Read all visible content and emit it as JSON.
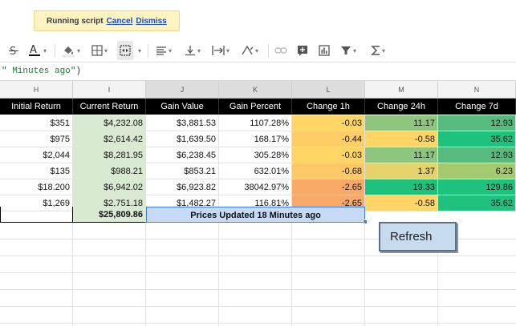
{
  "toast": {
    "label": "Running script",
    "cancel": "Cancel",
    "dismiss": "Dismiss"
  },
  "formula_bar": {
    "fragment": "\" Minutes ago\"",
    "close_paren": ")"
  },
  "columns": [
    "H",
    "I",
    "J",
    "K",
    "L",
    "M",
    "N"
  ],
  "headers": [
    "Initial Return",
    "Current Return",
    "Gain Value",
    "Gain Percent",
    "Change 1h",
    "Change 24h",
    "Change 7d"
  ],
  "rows": [
    [
      "$351",
      "$4,232.08",
      "$3,881.53",
      "1107.28%",
      "-0.03",
      "11.17",
      "12.93"
    ],
    [
      "$975",
      "$2,614.42",
      "$1,639.50",
      "168.17%",
      "-0.44",
      "-0.58",
      "35.62"
    ],
    [
      "$2,044",
      "$8,281.95",
      "$6,238.45",
      "305.28%",
      "-0.03",
      "11.17",
      "12.93"
    ],
    [
      "$135",
      "$988.21",
      "$853.21",
      "632.01%",
      "-0.68",
      "1.37",
      "6.23"
    ],
    [
      "$18.200",
      "$6,942.02",
      "$6,923.82",
      "38042.97%",
      "-2.65",
      "19.33",
      "129.86"
    ],
    [
      "$1,269",
      "$2,751.18",
      "$1,482.27",
      "116.81%",
      "-2.65",
      "-0.58",
      "35.62"
    ]
  ],
  "total": {
    "value": "$25,809.86",
    "status": "Prices Updated 18 Minutes ago"
  },
  "refresh_button": "Refresh",
  "colors": {
    "current_return_fill": "#d9ead3",
    "header_fill": "#000000",
    "change_orange": "#f6b26b",
    "change_yellow": "#ffd966",
    "change_green": "#93c47d",
    "change_teal": "#57bb8a",
    "status_fill": "#c9daf8"
  },
  "toolbar_icons": [
    "strikethrough-icon",
    "text-color-icon",
    "fill-color-icon",
    "borders-icon",
    "merge-cells-icon",
    "horizontal-align-icon",
    "vertical-align-icon",
    "text-wrap-icon",
    "text-rotation-icon",
    "insert-link-icon",
    "insert-comment-icon",
    "insert-chart-icon",
    "filter-icon",
    "functions-icon"
  ]
}
